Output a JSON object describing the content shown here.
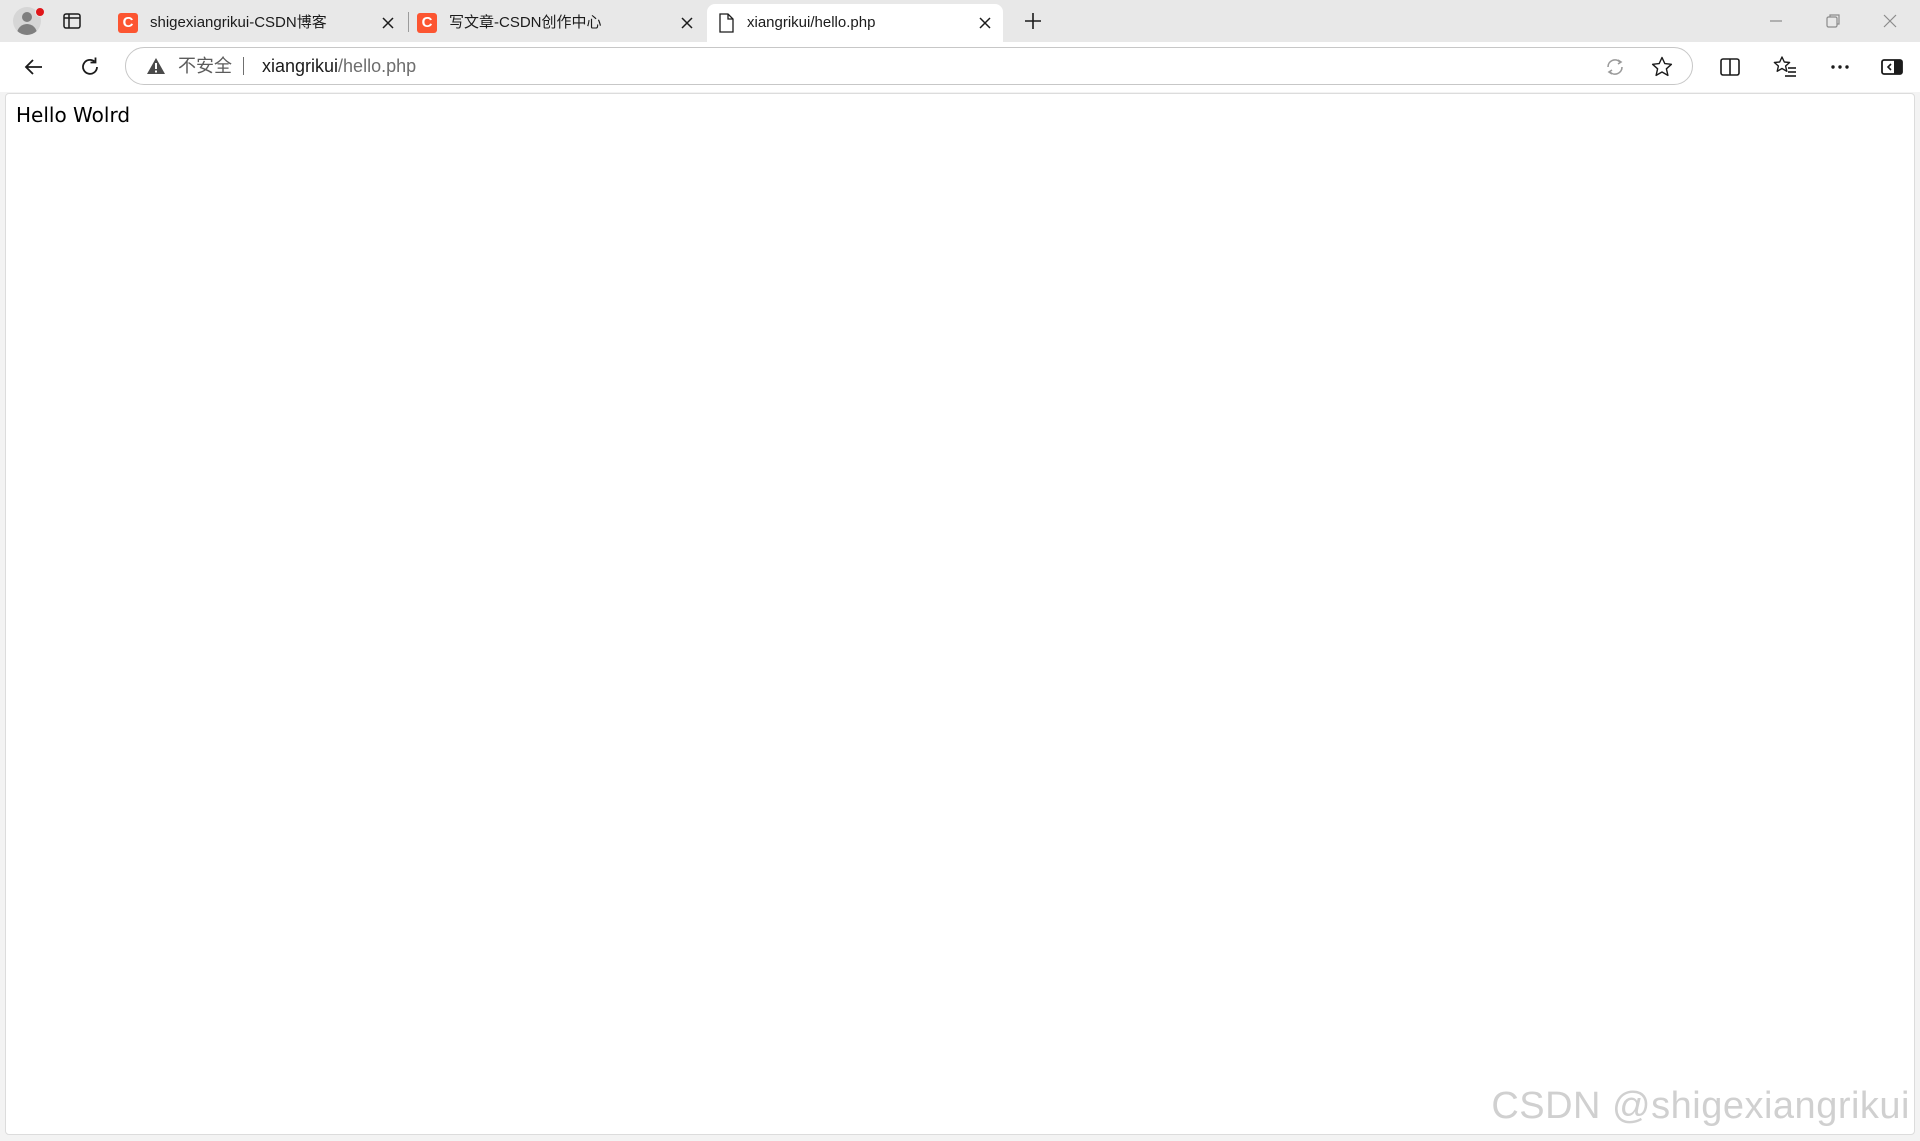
{
  "tabs": [
    {
      "title": "shigexiangrikui-CSDN博客",
      "favicon": "csdn-c-icon",
      "favicon_text": "C",
      "active": false
    },
    {
      "title": "写文章-CSDN创作中心",
      "favicon": "csdn-c-icon",
      "favicon_text": "C",
      "active": false
    },
    {
      "title": "xiangrikui/hello.php",
      "favicon": "document-icon",
      "active": true
    }
  ],
  "address_bar": {
    "security_label": "不安全",
    "url_host": "xiangrikui",
    "url_path": "/hello.php"
  },
  "page": {
    "body_text": "Hello Wolrd"
  },
  "watermark": "CSDN @shigexiangrikui",
  "colors": {
    "csdn_brand": "#fc5531",
    "tabstrip_bg": "#e8e8e8",
    "profile_notification": "#e0161a"
  }
}
